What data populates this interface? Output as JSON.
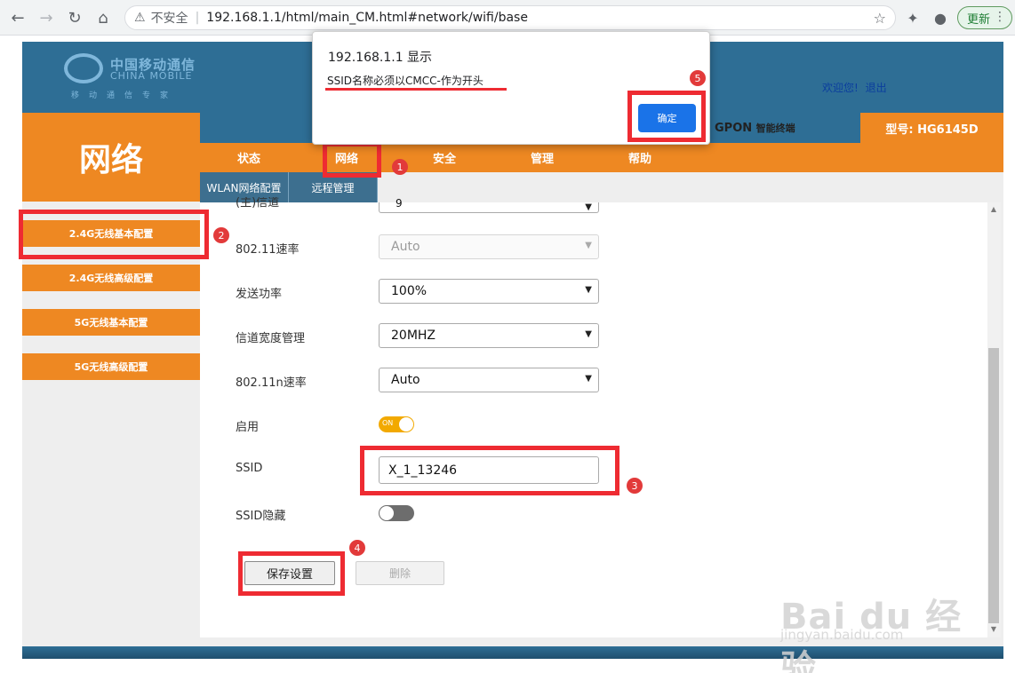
{
  "browser": {
    "insecure_label": "不安全",
    "url": "192.168.1.1/html/main_CM.html#network/wifi/base",
    "update_label": "更新"
  },
  "header": {
    "logo_cn": "中国移动通信",
    "logo_en": "CHINA MOBILE",
    "logo_slogan": "移动通信专家",
    "welcome": "欢迎您!",
    "logout": "退出",
    "device": "GPON",
    "device_suffix": "智能终端",
    "model": "型号: HG6145D"
  },
  "section_title": "网络",
  "nav": {
    "items": [
      "状态",
      "网络",
      "安全",
      "管理",
      "帮助"
    ],
    "active": "网络"
  },
  "subnav": [
    "WLAN网络配置",
    "远程管理"
  ],
  "sidebar": [
    "2.4G无线基本配置",
    "2.4G无线高级配置",
    "5G无线基本配置",
    "5G无线高级配置"
  ],
  "form": {
    "channel_label_partial": "(主)信道",
    "channel_value": "9",
    "rate_label": "802.11速率",
    "rate_value": "Auto",
    "power_label": "发送功率",
    "power_value": "100%",
    "bandwidth_label": "信道宽度管理",
    "bandwidth_value": "20MHZ",
    "n_rate_label": "802.11n速率",
    "n_rate_value": "Auto",
    "enable_label": "启用",
    "enable_toggle_text": "ON",
    "enable_state": true,
    "ssid_label": "SSID",
    "ssid_value": "X_1_13246",
    "hide_label": "SSID隐藏",
    "hide_state": false,
    "save_label": "保存设置",
    "delete_label": "删除"
  },
  "dialog": {
    "title": "192.168.1.1 显示",
    "message": "SSID名称必须以CMCC-作为开头",
    "ok": "确定"
  },
  "annotations": [
    "1",
    "2",
    "3",
    "4",
    "5"
  ],
  "watermark": {
    "main": "Bai du 经验",
    "sub": "jingyan.baidu.com"
  },
  "colors": {
    "orange": "#ee8822",
    "header_blue": "#2e6e95",
    "annotation_red": "#ee2b32",
    "toggle_on": "#f2a900",
    "dialog_button": "#1a73e8"
  }
}
